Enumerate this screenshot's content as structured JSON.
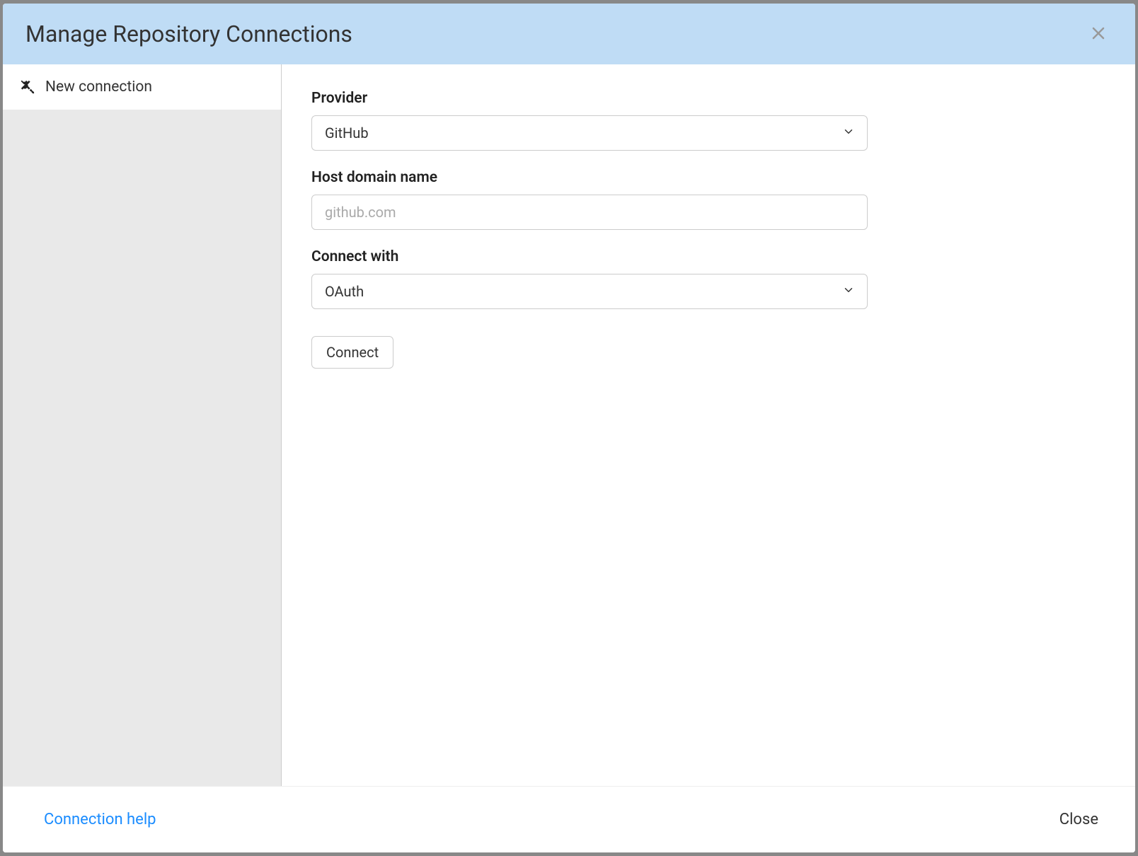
{
  "header": {
    "title": "Manage Repository Connections"
  },
  "sidebar": {
    "items": [
      {
        "label": "New connection",
        "icon": "plug-icon"
      }
    ]
  },
  "form": {
    "provider": {
      "label": "Provider",
      "value": "GitHub"
    },
    "host": {
      "label": "Host domain name",
      "placeholder": "github.com",
      "value": ""
    },
    "connect_with": {
      "label": "Connect with",
      "value": "OAuth"
    },
    "connect_button": "Connect"
  },
  "footer": {
    "help_link": "Connection help",
    "close_button": "Close"
  }
}
